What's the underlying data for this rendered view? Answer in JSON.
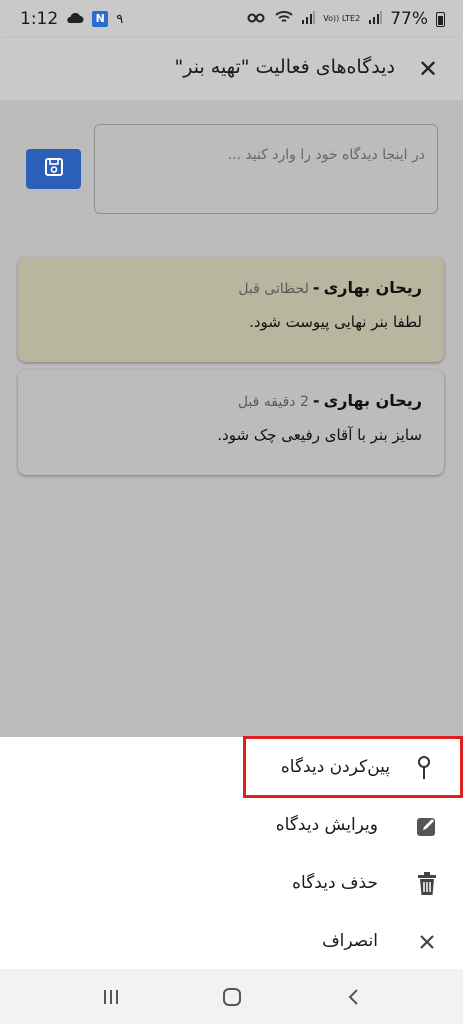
{
  "status_bar": {
    "time": "1:12",
    "app_badge": "N",
    "extra": "۹",
    "network": "Vo)) LTE2",
    "battery": "77%"
  },
  "app_bar": {
    "title": "دیدگاه‌های فعالیت \"تهیه بنر\"",
    "close": "✕"
  },
  "comment_form": {
    "placeholder": "در اینجا دیدگاه خود را وارد کنید ..."
  },
  "comments": [
    {
      "author": "ریحان بهاری",
      "separator": "-",
      "time": "لحظاتی قبل",
      "text": "لطفا بنر نهایی پیوست شود."
    },
    {
      "author": "ریحان بهاری",
      "separator": "-",
      "time": "2 دقیقه قبل",
      "text": "سایز بنر با آقای رفیعی چک شود."
    }
  ],
  "sheet": {
    "pin": "پین‌کردن دیدگاه",
    "edit": "ویرایش دیدگاه",
    "delete": "حذف دیدگاه",
    "cancel": "انصراف"
  },
  "colors": {
    "accent": "#2c5fb7",
    "pinned_card": "#b9b69f",
    "highlight": "#e02020"
  }
}
